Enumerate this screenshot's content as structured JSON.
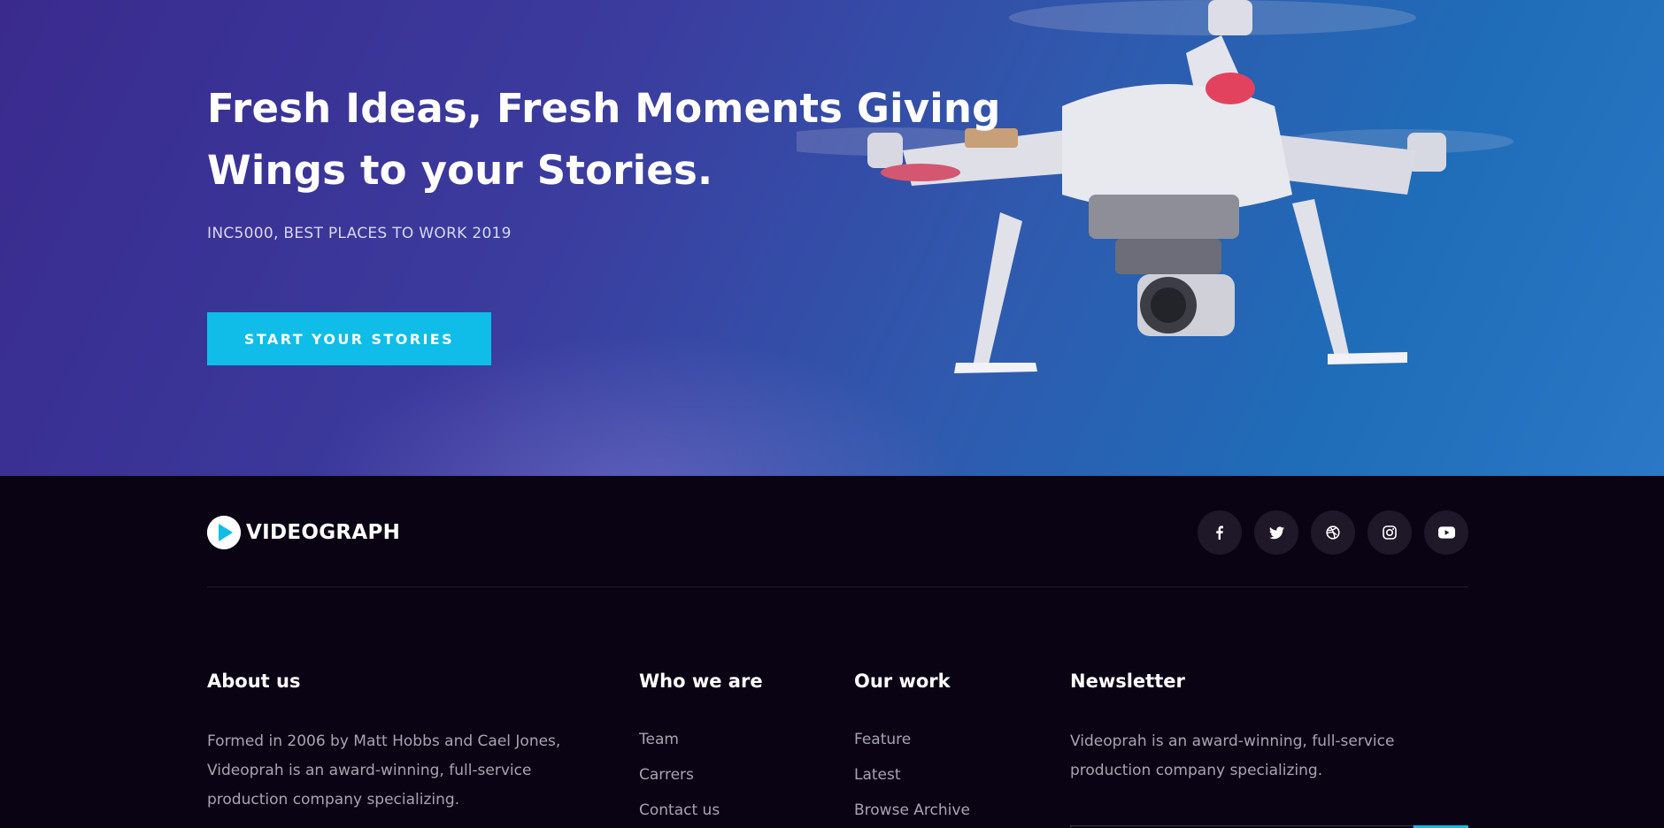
{
  "hero": {
    "title_line1": "Fresh Ideas, Fresh Moments Giving",
    "title_line2": "Wings to your Stories.",
    "subtitle": "INC5000, BEST PLACES TO WORK 2019",
    "cta_label": "START YOUR STORIES"
  },
  "footer": {
    "brand": {
      "name": "VIDEOGRAPH"
    },
    "socials": [
      {
        "icon": "facebook-icon"
      },
      {
        "icon": "twitter-icon"
      },
      {
        "icon": "dribbble-icon"
      },
      {
        "icon": "instagram-icon"
      },
      {
        "icon": "youtube-icon"
      }
    ],
    "about": {
      "heading": "About us",
      "text": "Formed in 2006 by Matt Hobbs and Cael Jones, Videoprah is an award-winning, full-service production company specializing."
    },
    "who_we_are": {
      "heading": "Who we are",
      "links": [
        "Team",
        "Carrers",
        "Contact us"
      ]
    },
    "our_work": {
      "heading": "Our work",
      "links": [
        "Feature",
        "Latest",
        "Browse Archive"
      ]
    },
    "newsletter": {
      "heading": "Newsletter",
      "text": "Videoprah is an award-winning, full-service production company specializing."
    }
  },
  "colors": {
    "accent": "#0fbde8",
    "footer_bg": "#0a0314",
    "hero_gradient_start": "#3a2a8e",
    "hero_gradient_end": "#2a78c6"
  }
}
